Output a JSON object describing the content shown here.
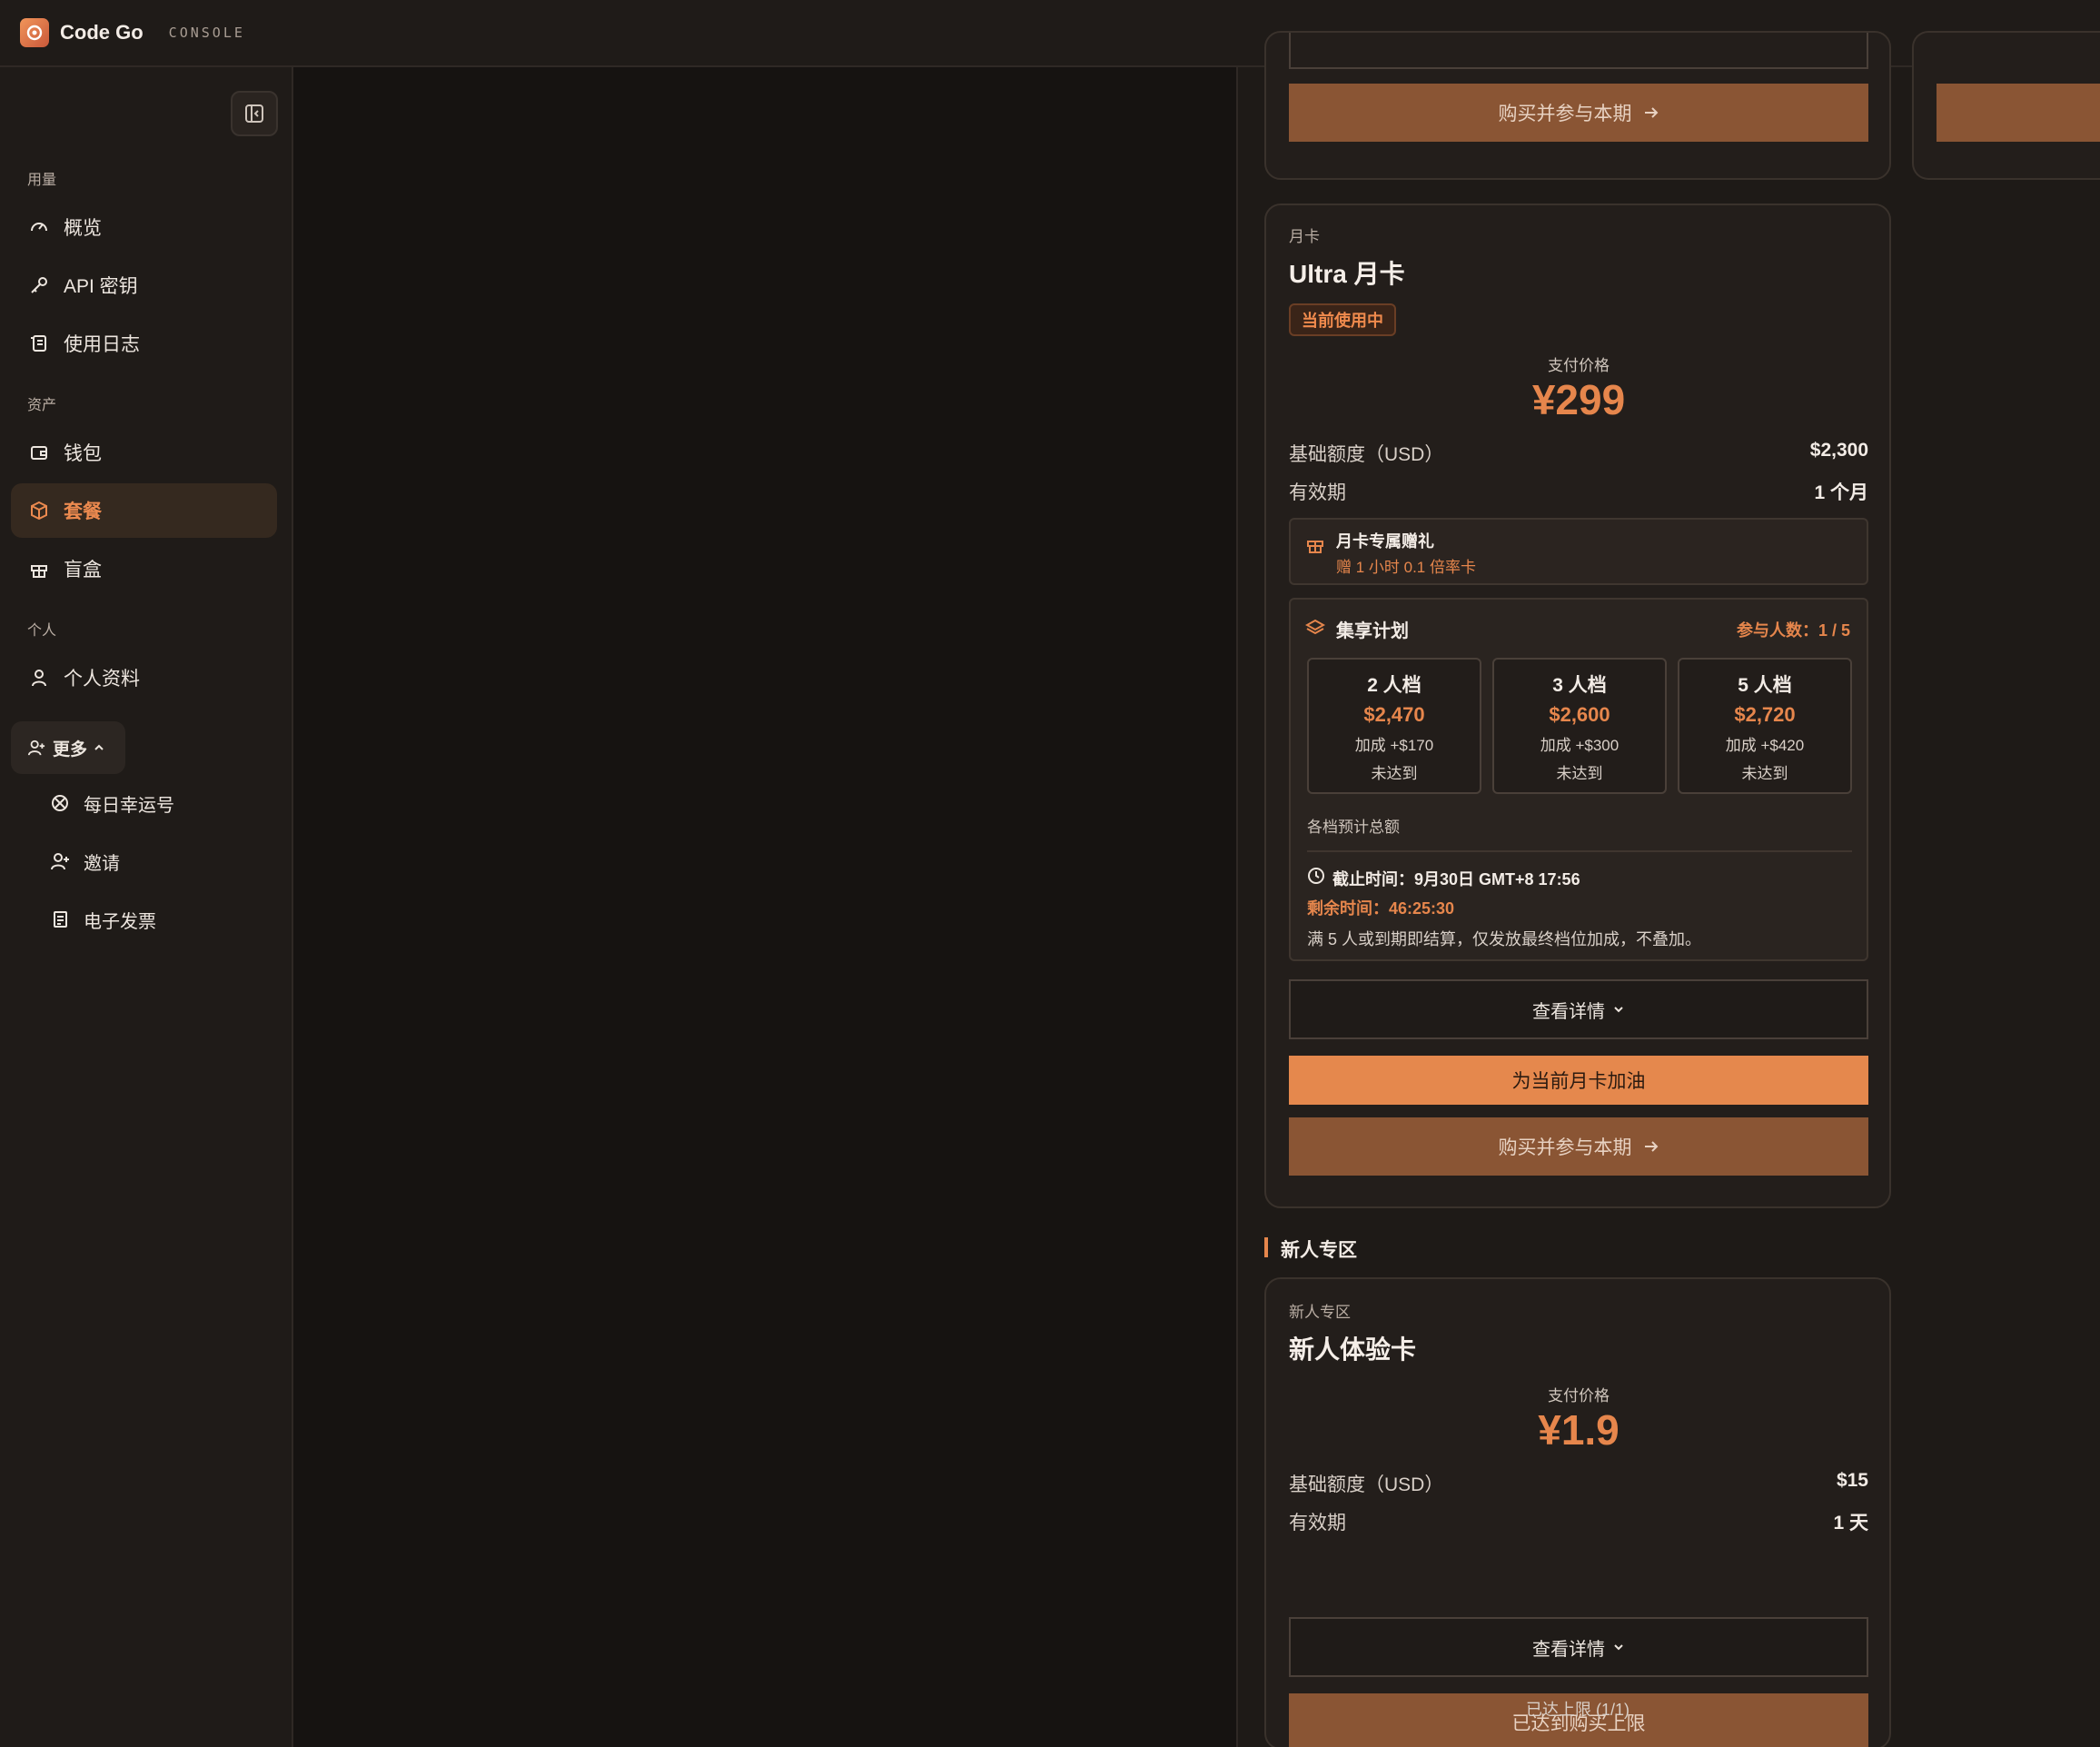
{
  "app": {
    "brand": "Code Go",
    "console_tag": "CONSOLE"
  },
  "sidebar": {
    "sections": {
      "usage": "用量",
      "assets": "资产",
      "personal": "个人"
    },
    "items": {
      "overview": "概览",
      "api_keys": "API 密钥",
      "usage_logs": "使用日志",
      "wallet": "钱包",
      "plans": "套餐",
      "blind_box": "盲盒",
      "profile": "个人资料"
    },
    "more": "更多",
    "sub_items": {
      "lucky_number": "每日幸运号",
      "invite": "邀请",
      "invoice": "电子发票"
    }
  },
  "top_card": {
    "buy_button": "购买并参与本期"
  },
  "ultra_card": {
    "category": "月卡",
    "title": "Ultra 月卡",
    "badge": "当前使用中",
    "price_label": "支付价格",
    "price": "¥299",
    "base_quota_label": "基础额度（USD）",
    "base_quota_value": "$2,300",
    "validity_label": "有效期",
    "validity_value": "1 个月",
    "gift_title": "月卡专属赠礼",
    "gift_desc": "赠 1 小时 0.1 倍率卡",
    "plan_title": "集享计划",
    "participants": "参与人数：1 / 5",
    "tiers": [
      {
        "name": "2 人档",
        "value": "$2,470",
        "bonus": "加成 +$170",
        "status": "未达到"
      },
      {
        "name": "3 人档",
        "value": "$2,600",
        "bonus": "加成 +$300",
        "status": "未达到"
      },
      {
        "name": "5 人档",
        "value": "$2,720",
        "bonus": "加成 +$420",
        "status": "未达到"
      }
    ],
    "tiers_note": "各档预计总额",
    "deadline": "截止时间：9月30日 GMT+8 17:56",
    "remaining": "剩余时间：46:25:30",
    "rule": "满 5 人或到期即结算，仅发放最终档位加成，不叠加。",
    "details_button": "查看详情",
    "refuel_button": "为当前月卡加油",
    "buy_button": "购买并参与本期"
  },
  "newbie_section": {
    "title": "新人专区"
  },
  "newbie_card": {
    "category": "新人专区",
    "title": "新人体验卡",
    "price_label": "支付价格",
    "price": "¥1.9",
    "base_quota_label": "基础额度（USD）",
    "base_quota_value": "$15",
    "validity_label": "有效期",
    "validity_value": "1 天",
    "details_button": "查看详情",
    "limit_button": "已达到购买上限",
    "limit_note": "已达上限 (1/1)"
  },
  "colors": {
    "accent": "#e6864c",
    "button_brown": "#8a5534",
    "button_orange": "#e5884d",
    "background": "#161311"
  }
}
